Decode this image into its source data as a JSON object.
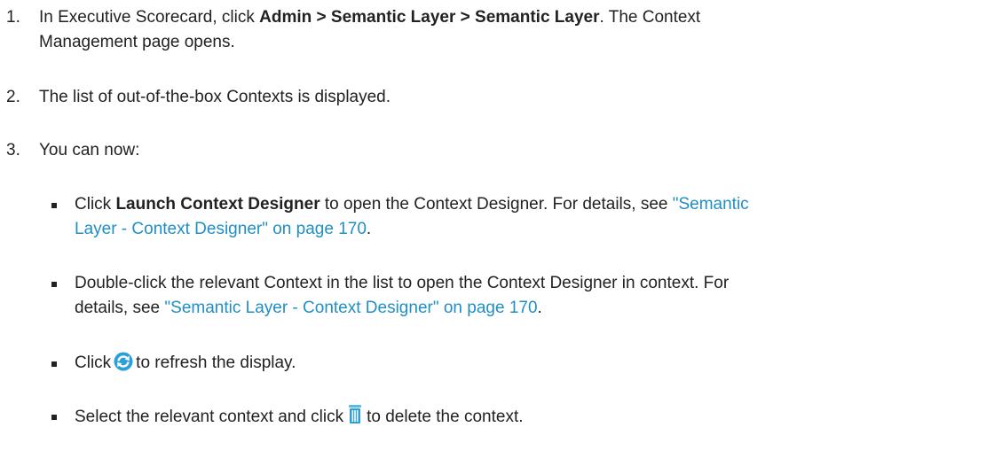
{
  "steps": [
    {
      "number": "1.",
      "line1_prefix": "In Executive Scorecard, click ",
      "line1_bold": "Admin > Semantic Layer > Semantic Layer",
      "line1_suffix": ". The Context",
      "line2": "Management page opens."
    },
    {
      "number": "2.",
      "text": "The list of out-of-the-box Contexts is displayed."
    },
    {
      "number": "3.",
      "text": "You can now:"
    }
  ],
  "bullets": {
    "launch": {
      "prefix": "Click ",
      "bold": "Launch Context Designer",
      "middle": " to open the Context Designer. For details, see ",
      "link_line1": "\"Semantic",
      "link_line2": "Layer - Context Designer\" on page 170",
      "suffix": "."
    },
    "double_click": {
      "line1": "Double-click the relevant Context in the list to open the Context Designer in context. For",
      "line2_prefix": "details, see ",
      "link": "\"Semantic Layer - Context Designer\" on page 170",
      "suffix": "."
    },
    "refresh": {
      "prefix": "Click",
      "icon": "refresh-icon",
      "suffix": "to refresh the display."
    },
    "delete": {
      "prefix": "Select the relevant context and click",
      "icon": "trash-icon",
      "suffix": "to delete the context."
    }
  },
  "colors": {
    "link": "#1f8fc6",
    "text": "#222222",
    "icon_blue": "#2a9fd8"
  }
}
